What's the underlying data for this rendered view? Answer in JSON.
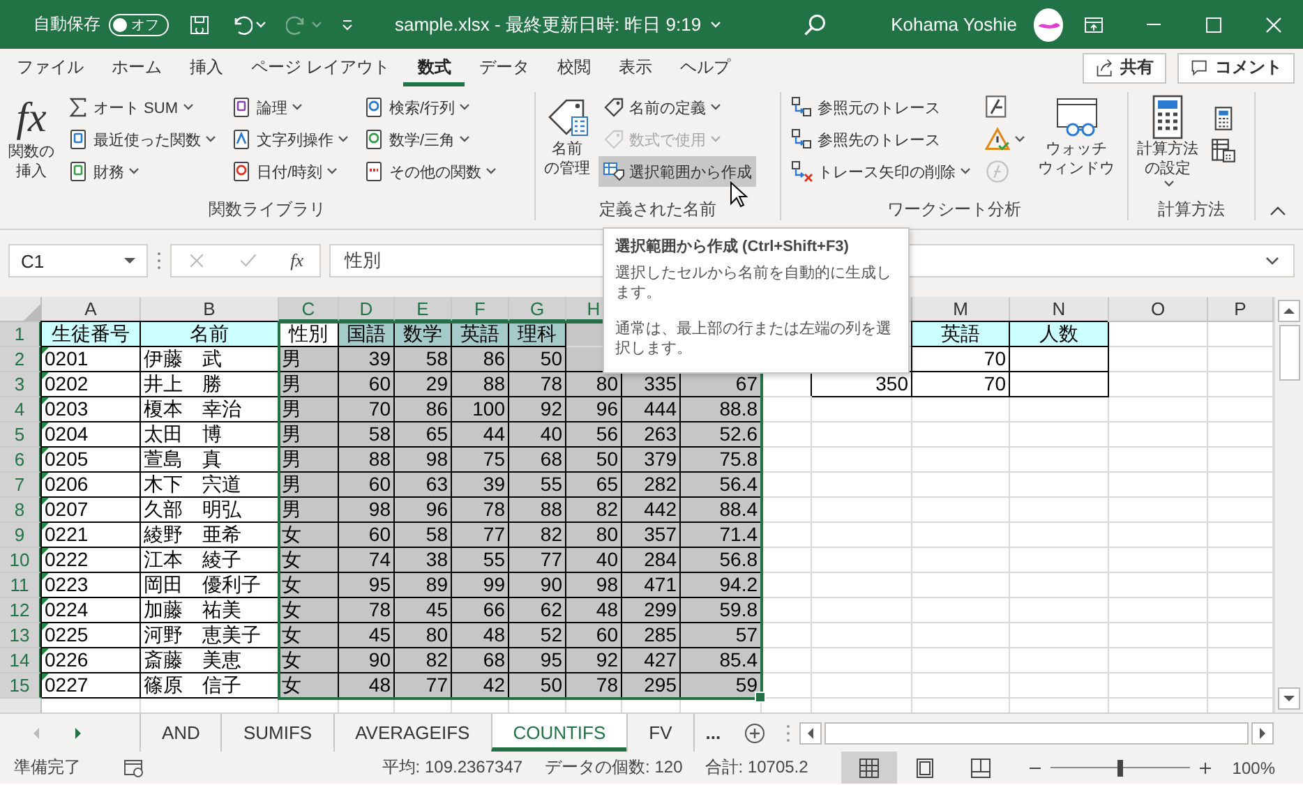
{
  "title_bar": {
    "autosave_label": "自動保存",
    "autosave_toggle": {
      "label": "オフ",
      "on": false
    },
    "redo_disabled": true,
    "title": "sample.xlsx - 最終更新日時: 昨日 9:19",
    "user": "Kohama Yoshie"
  },
  "ribbon_tabs": [
    {
      "label": "ファイル",
      "selected": false
    },
    {
      "label": "ホーム",
      "selected": false
    },
    {
      "label": "挿入",
      "selected": false
    },
    {
      "label": "ページ レイアウト",
      "selected": false
    },
    {
      "label": "数式",
      "selected": true
    },
    {
      "label": "データ",
      "selected": false
    },
    {
      "label": "校閲",
      "selected": false
    },
    {
      "label": "表示",
      "selected": false
    },
    {
      "label": "ヘルプ",
      "selected": false
    }
  ],
  "share_button": "共有",
  "comment_button": "コメント",
  "ribbon_groups": [
    {
      "label": "関数ライブラリ",
      "items": [
        {
          "kind": "large",
          "icon_text": "fx",
          "lines": [
            "関数の",
            "挿入"
          ],
          "dropdown": false
        },
        {
          "kind": "column",
          "entries": [
            {
              "label": "オート SUM",
              "dropdown": true
            },
            {
              "label": "最近使った関数",
              "dropdown": true
            },
            {
              "label": "財務",
              "dropdown": true
            }
          ]
        },
        {
          "kind": "column",
          "entries": [
            {
              "label": "論理",
              "dropdown": true
            },
            {
              "label": "文字列操作",
              "dropdown": true
            },
            {
              "label": "日付/時刻",
              "dropdown": true
            }
          ]
        },
        {
          "kind": "column",
          "entries": [
            {
              "label": "検索/行列",
              "dropdown": true
            },
            {
              "label": "数学/三角",
              "dropdown": true
            },
            {
              "label": "その他の関数",
              "dropdown": true
            }
          ]
        }
      ]
    },
    {
      "label": "定義された名前",
      "items": [
        {
          "kind": "large",
          "lines": [
            "名前",
            "の管理"
          ],
          "dropdown": false
        },
        {
          "kind": "column",
          "entries": [
            {
              "label": "名前の定義",
              "dropdown": true,
              "disabled": false,
              "hovered": false
            },
            {
              "label": "数式で使用",
              "dropdown": true,
              "disabled": true,
              "hovered": false
            },
            {
              "label": "選択範囲から作成",
              "dropdown": false,
              "disabled": false,
              "hovered": true
            }
          ]
        }
      ]
    },
    {
      "label": "ワークシート分析",
      "items": [
        {
          "kind": "column",
          "entries": [
            {
              "label": "参照元のトレース",
              "dropdown": false
            },
            {
              "label": "参照先のトレース",
              "dropdown": false
            },
            {
              "label": "トレース矢印の削除",
              "dropdown": true
            }
          ]
        },
        {
          "kind": "icons",
          "entries": [
            {
              "dropdown": false,
              "disabled": false
            },
            {
              "dropdown": true,
              "disabled": false
            },
            {
              "dropdown": false,
              "disabled": true
            }
          ]
        },
        {
          "kind": "large",
          "lines": [
            "ウォッチ",
            "ウィンドウ"
          ],
          "dropdown": false
        }
      ]
    },
    {
      "label": "計算方法",
      "items": [
        {
          "kind": "large",
          "lines": [
            "計算方法",
            "の設定"
          ],
          "dropdown": true
        },
        {
          "kind": "icons",
          "entries": [
            {
              "dropdown": false,
              "disabled": false
            },
            {
              "dropdown": false,
              "disabled": false
            }
          ]
        }
      ]
    }
  ],
  "tooltip": {
    "title": "選択範囲から作成 (Ctrl+Shift+F3)",
    "paragraphs": [
      "選択したセルから名前を自動的に生成します。",
      "通常は、最上部の行または左端の列を選択します。"
    ]
  },
  "formula_bar": {
    "name_box": "C1",
    "icon_text": "fx",
    "content": "性別"
  },
  "grid": {
    "columns": [
      {
        "label": "A",
        "selected": false,
        "kind": "text"
      },
      {
        "label": "B",
        "selected": false,
        "kind": "text"
      },
      {
        "label": "C",
        "selected": true,
        "kind": "text"
      },
      {
        "label": "D",
        "selected": true,
        "kind": "number"
      },
      {
        "label": "E",
        "selected": true,
        "kind": "number"
      },
      {
        "label": "F",
        "selected": true,
        "kind": "number"
      },
      {
        "label": "G",
        "selected": true,
        "kind": "number"
      },
      {
        "label": "H",
        "selected": true,
        "kind": "number"
      },
      {
        "selected": true,
        "kind": "number"
      },
      {
        "selected": true,
        "kind": "number"
      },
      {
        "kind": "number"
      },
      {
        "kind": "number"
      },
      {
        "label": "M",
        "selected": false,
        "kind": "number"
      },
      {
        "label": "N",
        "selected": false,
        "kind": "number"
      },
      {
        "label": "O",
        "selected": false,
        "kind": "number"
      },
      {
        "label": "P",
        "selected": false,
        "kind": "number"
      }
    ],
    "rows": [
      {
        "number": "1",
        "selected": true,
        "kind": "header",
        "flag": false,
        "cells": [
          "生徒番号",
          "名前",
          {
            "text": "性別",
            "active": true
          },
          "国語",
          "数学",
          "英語",
          "理科",
          null,
          null,
          null,
          null,
          null,
          "英語",
          "人数"
        ]
      },
      {
        "number": "2",
        "selected": true,
        "kind": "data",
        "flag": true,
        "cells": [
          "0201",
          "伊藤　武",
          "男",
          "39",
          "58",
          "86",
          "50",
          null,
          null,
          null,
          null,
          null,
          "70",
          {
            "bordered": true
          }
        ]
      },
      {
        "number": "3",
        "selected": true,
        "kind": "data",
        "flag": true,
        "cells": [
          "0202",
          "井上　勝",
          "男",
          "60",
          "29",
          "88",
          "78",
          "80",
          "335",
          "67",
          null,
          "350",
          "70",
          {
            "bordered": true
          }
        ]
      },
      {
        "number": "4",
        "selected": true,
        "kind": "data",
        "flag": true,
        "cells": [
          "0203",
          "榎本　幸治",
          "男",
          "70",
          "86",
          "100",
          "92",
          "96",
          "444",
          "88.8"
        ]
      },
      {
        "number": "5",
        "selected": true,
        "kind": "data",
        "flag": true,
        "cells": [
          "0204",
          "太田　博",
          "男",
          "58",
          "65",
          "44",
          "40",
          "56",
          "263",
          "52.6"
        ]
      },
      {
        "number": "6",
        "selected": true,
        "kind": "data",
        "flag": true,
        "cells": [
          "0205",
          "萱島　真",
          "男",
          "88",
          "98",
          "75",
          "68",
          "50",
          "379",
          "75.8"
        ]
      },
      {
        "number": "7",
        "selected": true,
        "kind": "data",
        "flag": true,
        "cells": [
          "0206",
          "木下　宍道",
          "男",
          "60",
          "63",
          "39",
          "55",
          "65",
          "282",
          "56.4"
        ]
      },
      {
        "number": "8",
        "selected": true,
        "kind": "data",
        "flag": true,
        "cells": [
          "0207",
          "久部　明弘",
          "男",
          "98",
          "96",
          "78",
          "88",
          "82",
          "442",
          "88.4"
        ]
      },
      {
        "number": "9",
        "selected": true,
        "kind": "data",
        "flag": true,
        "cells": [
          "0221",
          "綾野　亜希",
          "女",
          "60",
          "58",
          "77",
          "82",
          "80",
          "357",
          "71.4"
        ]
      },
      {
        "number": "10",
        "selected": true,
        "kind": "data",
        "flag": true,
        "cells": [
          "0222",
          "江本　綾子",
          "女",
          "74",
          "38",
          "55",
          "77",
          "40",
          "284",
          "56.8"
        ]
      },
      {
        "number": "11",
        "selected": true,
        "kind": "data",
        "flag": true,
        "cells": [
          "0223",
          "岡田　優利子",
          "女",
          "95",
          "89",
          "99",
          "90",
          "98",
          "471",
          "94.2"
        ]
      },
      {
        "number": "12",
        "selected": true,
        "kind": "data",
        "flag": true,
        "cells": [
          "0224",
          "加藤　祐美",
          "女",
          "78",
          "45",
          "66",
          "62",
          "48",
          "299",
          "59.8"
        ]
      },
      {
        "number": "13",
        "selected": true,
        "kind": "data",
        "flag": true,
        "cells": [
          "0225",
          "河野　恵美子",
          "女",
          "45",
          "80",
          "48",
          "52",
          "60",
          "285",
          "57"
        ]
      },
      {
        "number": "14",
        "selected": true,
        "kind": "data",
        "flag": true,
        "cells": [
          "0226",
          "斎藤　美恵",
          "女",
          "90",
          "82",
          "68",
          "95",
          "92",
          "427",
          "85.4"
        ]
      },
      {
        "number": "15",
        "selected": true,
        "kind": "data",
        "flag": true,
        "cells": [
          "0227",
          "篠原　信子",
          "女",
          "48",
          "77",
          "42",
          "50",
          "78",
          "295",
          "59"
        ]
      }
    ]
  },
  "sheet_tabs": [
    {
      "label": "AND",
      "selected": false
    },
    {
      "label": "SUMIFS",
      "selected": false
    },
    {
      "label": "AVERAGEIFS",
      "selected": false
    },
    {
      "label": "COUNTIFS",
      "selected": true
    },
    {
      "label": "FV",
      "selected": false
    }
  ],
  "more_sheets": "...",
  "status_bar": {
    "ready": "準備完了",
    "average": "平均: 109.2367347",
    "count": "データの個数: 120",
    "sum": "合計: 10705.2",
    "views": [
      {
        "selected": true
      },
      {
        "selected": false
      },
      {
        "selected": false
      }
    ],
    "zoom": {
      "level": 0.5,
      "label": "100%"
    }
  }
}
